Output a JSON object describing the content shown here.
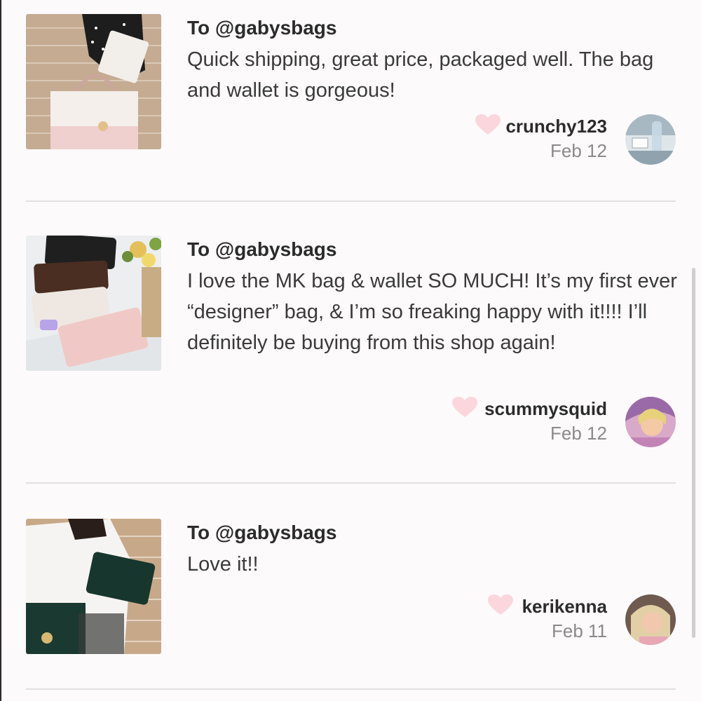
{
  "reviews": [
    {
      "to": "To @gabysbags",
      "text": "Quick shipping, great price, packaged well. The bag and wallet is gorgeous!",
      "author": "crunchy123",
      "date": "Feb 12",
      "image_icon": "product-photo-tote-and-wallet",
      "avatar_icon": "user-avatar"
    },
    {
      "to": "To @gabysbags",
      "text": "I love the MK bag & wallet SO MUCH! It’s my first ever “designer” bag, & I’m so freaking happy with it!!!! I’ll definitely be buying from this shop again!",
      "author": "scummysquid",
      "date": "Feb 12",
      "image_icon": "product-photo-wallets",
      "avatar_icon": "user-avatar"
    },
    {
      "to": "To @gabysbags",
      "text": "Love it!!",
      "author": "kerikenna",
      "date": "Feb 11",
      "image_icon": "product-photo-green-bag",
      "avatar_icon": "user-avatar"
    }
  ],
  "colors": {
    "heart": "#fcd6dd",
    "divider": "#e3e0e1",
    "text": "#3a3a3a",
    "muted": "#8a8a8a"
  }
}
